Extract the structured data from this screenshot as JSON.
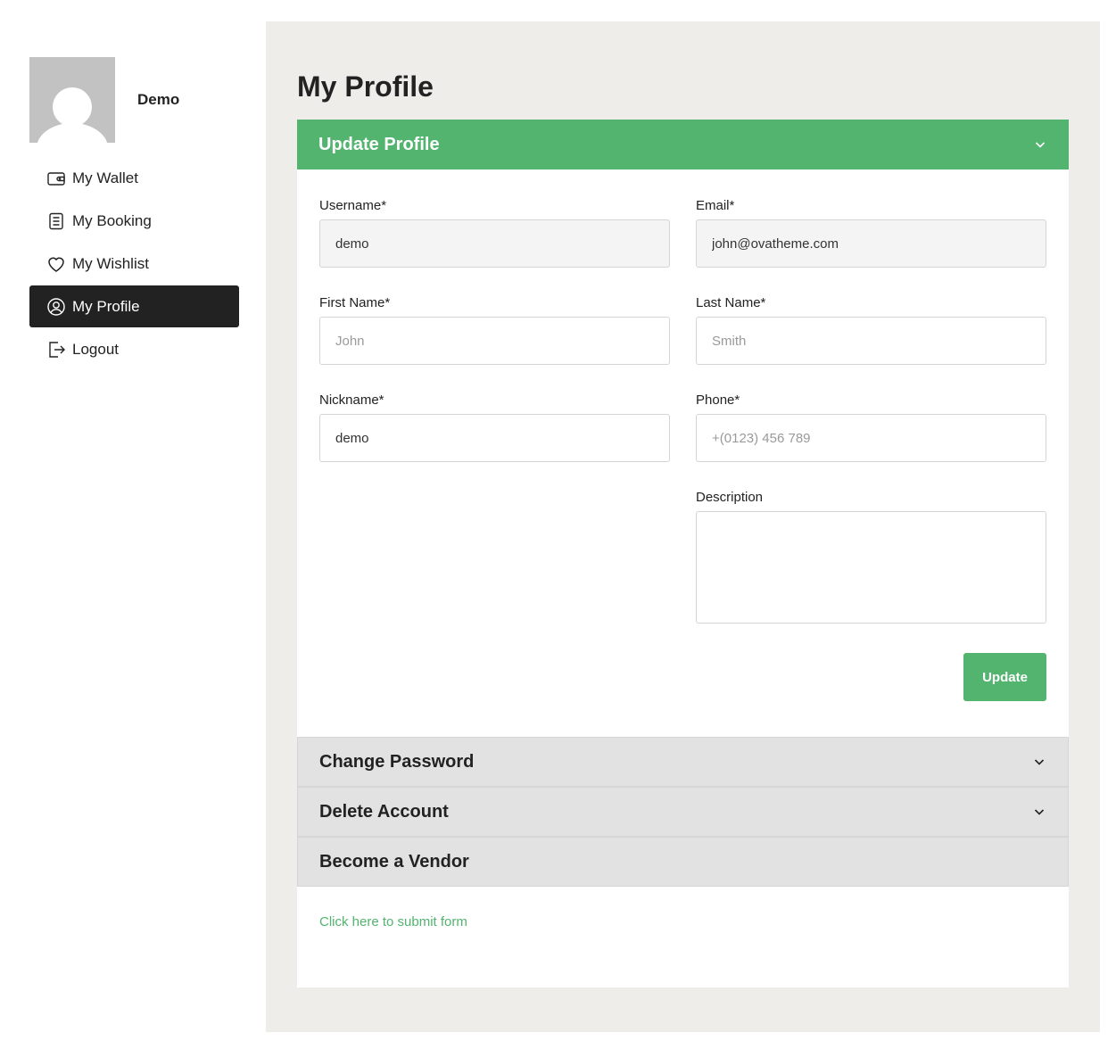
{
  "user": {
    "name": "Demo"
  },
  "nav": {
    "items": [
      {
        "label": "My Wallet",
        "icon": "wallet-icon"
      },
      {
        "label": "My Booking",
        "icon": "list-icon"
      },
      {
        "label": "My Wishlist",
        "icon": "heart-icon"
      },
      {
        "label": "My Profile",
        "icon": "user-circle-icon",
        "active": true
      },
      {
        "label": "Logout",
        "icon": "logout-icon"
      }
    ]
  },
  "page": {
    "title": "My Profile"
  },
  "update_profile": {
    "heading": "Update Profile",
    "username": {
      "label": "Username*",
      "value": "demo"
    },
    "email": {
      "label": "Email*",
      "value": "john@ovatheme.com"
    },
    "first_name": {
      "label": "First Name*",
      "placeholder": "John"
    },
    "last_name": {
      "label": "Last Name*",
      "placeholder": "Smith"
    },
    "nickname": {
      "label": "Nickname*",
      "value": "demo"
    },
    "phone": {
      "label": "Phone*",
      "placeholder": "+(0123) 456 789"
    },
    "description": {
      "label": "Description",
      "value": ""
    },
    "submit_label": "Update"
  },
  "change_password": {
    "heading": "Change Password"
  },
  "delete_account": {
    "heading": "Delete Account"
  },
  "become_vendor": {
    "heading": "Become a Vendor",
    "link_text": "Click here to submit form"
  },
  "colors": {
    "accent": "#52b46f",
    "active_nav": "#222222",
    "panel_bg": "#eeede9"
  }
}
